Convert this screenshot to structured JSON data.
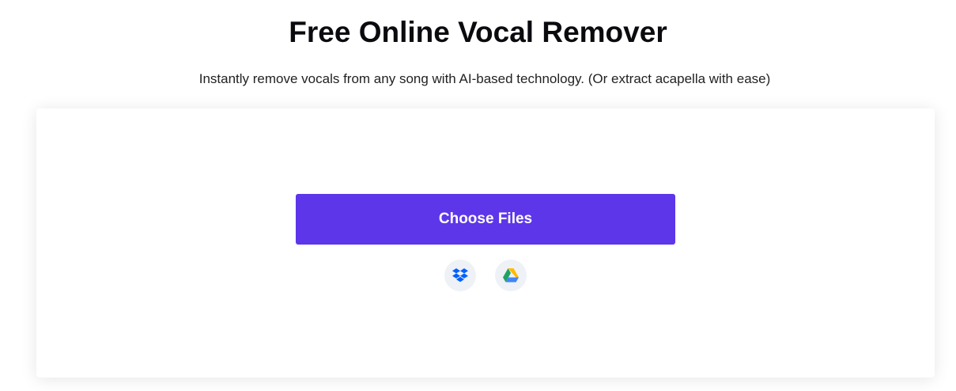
{
  "header": {
    "title": "Free Online Vocal Remover",
    "subtitle": "Instantly remove vocals from any song with AI-based technology. (Or extract acapella with ease)"
  },
  "upload": {
    "choose_files_label": "Choose Files",
    "sources": [
      {
        "name": "Dropbox",
        "icon": "dropbox-icon"
      },
      {
        "name": "Google Drive",
        "icon": "google-drive-icon"
      }
    ]
  },
  "colors": {
    "accent": "#5d36ea",
    "icon_bg": "#eef1f6",
    "dropbox_blue": "#0061fe",
    "drive_green": "#1ea362",
    "drive_yellow": "#ffba00",
    "drive_blue": "#4285f4"
  }
}
